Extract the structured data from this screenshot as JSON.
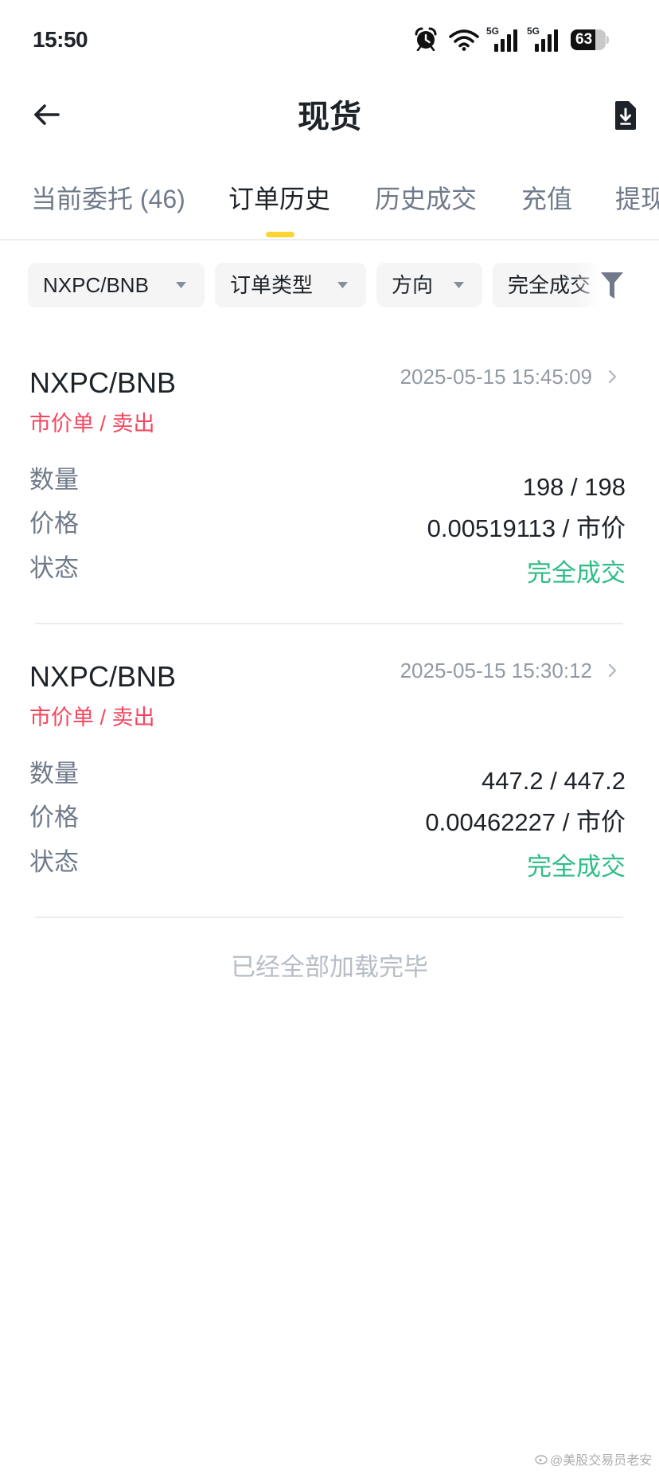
{
  "status_bar": {
    "time": "15:50",
    "icons": [
      "alarm-clock-icon",
      "wifi-icon",
      "signal-5g-icon",
      "signal-5g-icon",
      "battery-icon"
    ],
    "signal_1_label": "5G",
    "signal_2_label": "5G",
    "battery_level": "63"
  },
  "header": {
    "title": "现货",
    "back_icon": "arrow-left-icon",
    "action_icon": "download-document-icon"
  },
  "tabs": [
    {
      "label": "当前委托 (46)",
      "active": false
    },
    {
      "label": "订单历史",
      "active": true
    },
    {
      "label": "历史成交",
      "active": false
    },
    {
      "label": "充值",
      "active": false
    },
    {
      "label": "提现",
      "active": false
    }
  ],
  "filters": {
    "pair": "NXPC/BNB",
    "order_type": "订单类型",
    "direction": "方向",
    "status": "完全成交",
    "dropdown_icon": "caret-down-icon",
    "filter_icon": "funnel-icon"
  },
  "row_labels": {
    "amount": "数量",
    "price": "价格",
    "status": "状态"
  },
  "orders": [
    {
      "pair": "NXPC/BNB",
      "time": "2025-05-15 15:45:09",
      "type_side": "市价单 / 卖出",
      "amount": "198 / 198",
      "price": "0.00519113 / 市价",
      "status": "完全成交"
    },
    {
      "pair": "NXPC/BNB",
      "time": "2025-05-15 15:30:12",
      "type_side": "市价单 / 卖出",
      "amount": "447.2 / 447.2",
      "price": "0.00462227 / 市价",
      "status": "完全成交"
    }
  ],
  "footer_text": "已经全部加载完毕",
  "watermark": "@美股交易员老安",
  "colors": {
    "text_primary": "#1E2329",
    "text_secondary": "#707A8A",
    "text_muted": "#929AA5",
    "text_faint": "#B7BDC6",
    "sell_red": "#F6465D",
    "filled_green": "#2EBD85",
    "accent_yellow": "#FCD535",
    "chip_bg": "#F5F5F5",
    "divider": "#EAECEF"
  }
}
